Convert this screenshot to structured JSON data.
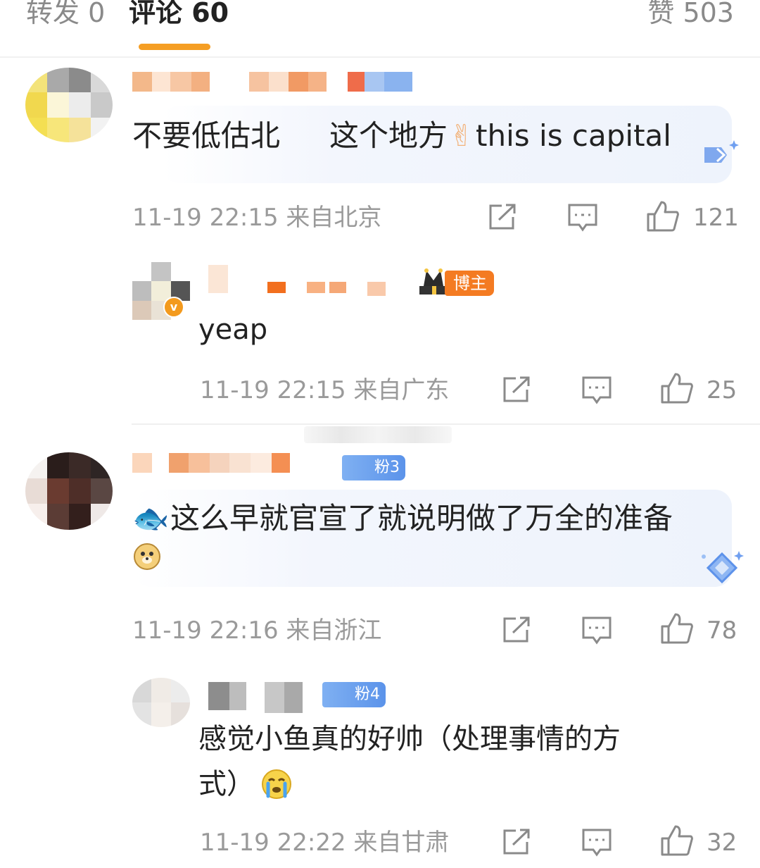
{
  "tabs": {
    "repost": "转发 0",
    "comments": "评论 60",
    "likes": "赞 503"
  },
  "colors": {
    "accent": "#f59e24",
    "muted_text": "#9a9a9a",
    "bubble_bg": "#eef3fc",
    "host_badge": "#f47b22",
    "fan_badge": "#5b93ea"
  },
  "comments": [
    {
      "text_a": "不要低估北",
      "text_b": "这个地方",
      "emoji_icon": "finger-heart-emoji",
      "text_c": "this is capital",
      "time": "11-19 22:15",
      "location": "来自北京",
      "likes": "121",
      "reply": {
        "badge": "博主",
        "verified": "v",
        "text": "yeap",
        "time": "11-19 22:15",
        "location": "来自广东",
        "likes": "25"
      }
    },
    {
      "fan_badge": "粉3",
      "emoji_icon": "fish-emoji",
      "text_line1": "这么早就官宣了就说明做了万全的准备",
      "trailing_emoji": "doge-emoji",
      "time": "11-19 22:16",
      "location": "来自浙江",
      "likes": "78",
      "reply": {
        "fan_badge": "粉4",
        "text_line1": "感觉小鱼真的好帅（处理事情的方",
        "text_line2": "式）",
        "trailing_emoji": "crying-emoji",
        "time": "11-19 22:22",
        "location": "来自甘肃",
        "likes": "32"
      }
    }
  ]
}
